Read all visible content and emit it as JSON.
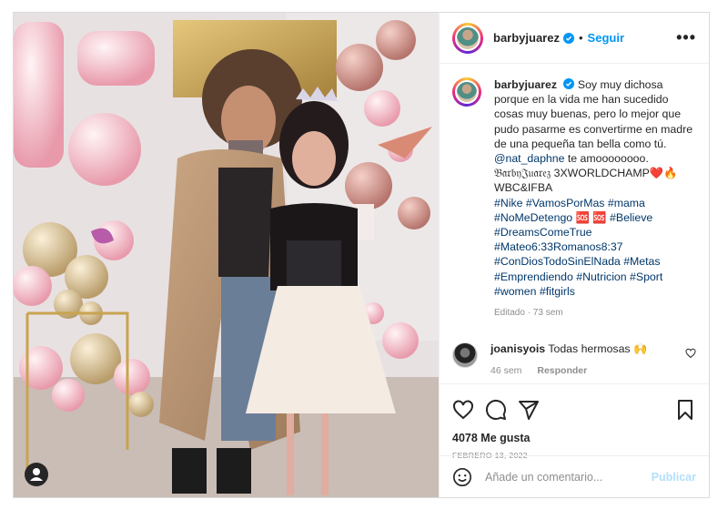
{
  "header": {
    "username": "barbyjuarez",
    "follow_label": "Seguir",
    "separator": "•",
    "more_label": "•••"
  },
  "caption": {
    "username": "barbyjuarez",
    "text_1": "Soy muy dichosa porque en la vida me han sucedido cosas muy buenas, pero lo mejor que pudo pasarme es convertirme en madre de una pequeña tan bella como tú.",
    "mention": "@nat_daphne",
    "text_2": "te amoooooooo. 𝔅𝔞𝔯𝔟𝔶𝔍𝔲𝔞𝔯𝔢𝔷",
    "text_3": "3XWORLDCHAMP❤️🔥WBC&IFBA",
    "line_tags_1": [
      "#Nike",
      "#VamosPorMas",
      "#mama"
    ],
    "line_tags_2": [
      "#NoMeDetengo",
      "🆘",
      "🆘",
      "#Believe"
    ],
    "line_tags_3": [
      "#DreamsComeTrue"
    ],
    "line_tags_4": [
      "#Mateo6:33Romanos8:37"
    ],
    "line_tags_5": [
      "#ConDiosTodoSinElNada",
      "#Metas"
    ],
    "line_tags_6": [
      "#Emprendiendo",
      "#Nutricion",
      "#Sport"
    ],
    "line_tags_7": [
      "#women",
      "#fitgirls"
    ],
    "meta": "Editado · 73 sem"
  },
  "comment": {
    "username": "joanisyois",
    "text": "Todas hermosas 🙌",
    "time": "46 sem",
    "reply_label": "Responder"
  },
  "stats": {
    "likes": "4078 Me gusta",
    "date": "FEBRERO 13, 2022"
  },
  "add_comment": {
    "placeholder": "Añade un comentario...",
    "publish_label": "Publicar"
  },
  "colors": {
    "link_blue": "#0095f6",
    "hashtag": "#00376b",
    "muted": "#8e8e8e",
    "publish_disabled": "#b2dffc",
    "verified": "#0095f6"
  },
  "icons": [
    "verified-icon",
    "more-icon",
    "heart-icon",
    "comment-icon",
    "share-icon",
    "save-icon",
    "emoji-icon",
    "heart-small-icon",
    "user-tag-icon"
  ]
}
